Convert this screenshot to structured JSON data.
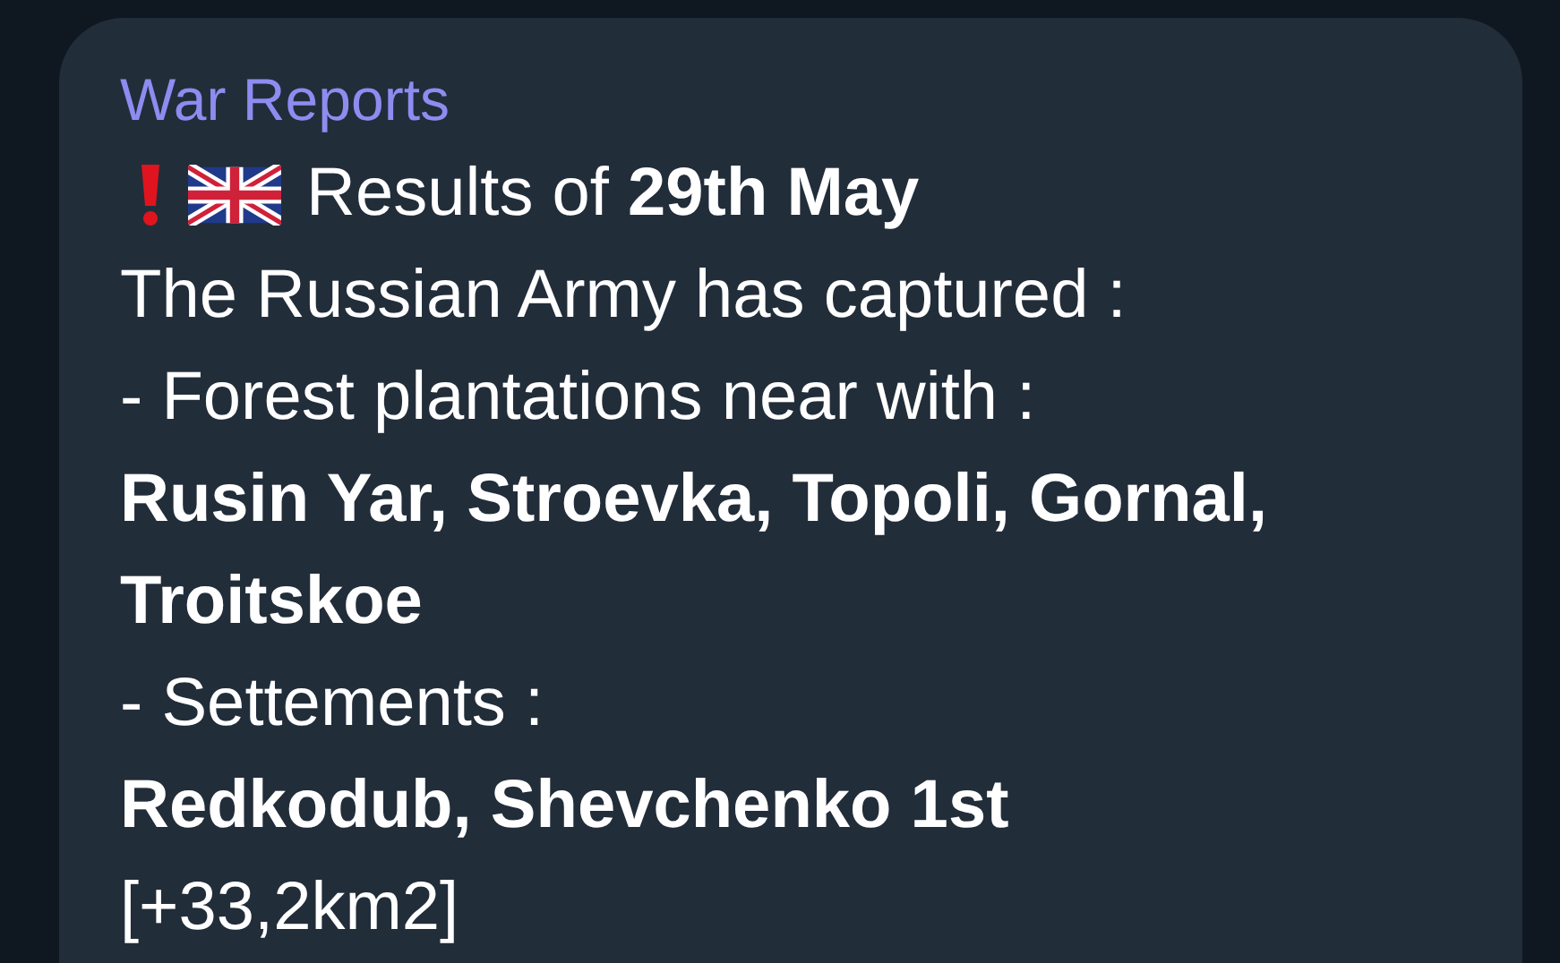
{
  "message": {
    "sender": "War Reports",
    "lines": [
      {
        "kind": "header",
        "text": "Results of **29th May**"
      },
      {
        "kind": "plain",
        "text": "The Russian Army has captured :"
      },
      {
        "kind": "plain",
        "text": "- Forest plantations near with :"
      },
      {
        "kind": "bold",
        "text": "Rusin Yar, Stroevka, Topoli, Gornal, Troitskoe"
      },
      {
        "kind": "plain",
        "text": "- Settements :"
      },
      {
        "kind": "bold",
        "text": "Redkodub, Shevchenko 1st"
      },
      {
        "kind": "plain",
        "text": "[+33,2km2]"
      }
    ]
  }
}
